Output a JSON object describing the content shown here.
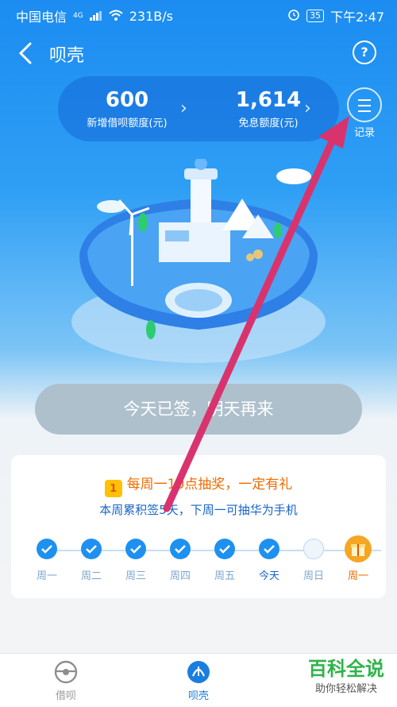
{
  "status_bar": {
    "carrier": "中国电信",
    "network": "4G",
    "speed": "231B/s",
    "battery": "35",
    "time": "下午2:47"
  },
  "nav": {
    "title": "呗壳",
    "help": "?"
  },
  "stats": [
    {
      "value": "600",
      "label": "新增借呗额度(元)"
    },
    {
      "value": "1,614",
      "label": "免息额度(元)"
    }
  ],
  "record": {
    "label": "记录"
  },
  "sign_button": {
    "label": "今天已签，明天再来"
  },
  "card": {
    "headline": "每周一10点抽奖，一定有礼",
    "calendar_digit": "1",
    "subline": "本周累积签5天，下周一可抽华为手机",
    "days": [
      {
        "label": "周一",
        "state": "checked"
      },
      {
        "label": "周二",
        "state": "checked"
      },
      {
        "label": "周三",
        "state": "checked"
      },
      {
        "label": "周四",
        "state": "checked"
      },
      {
        "label": "周五",
        "state": "checked"
      },
      {
        "label": "今天",
        "state": "checked"
      },
      {
        "label": "周日",
        "state": "empty"
      },
      {
        "label": "周一",
        "state": "gift"
      }
    ]
  },
  "tabs": [
    {
      "label": "借呗",
      "active": false
    },
    {
      "label": "呗壳",
      "active": true
    }
  ],
  "watermark": {
    "title": "百科全说",
    "subtitle": "助你轻松解决"
  },
  "colors": {
    "primary": "#1e90f0",
    "accent": "#ef6c00",
    "arrow": "#d9336e"
  }
}
